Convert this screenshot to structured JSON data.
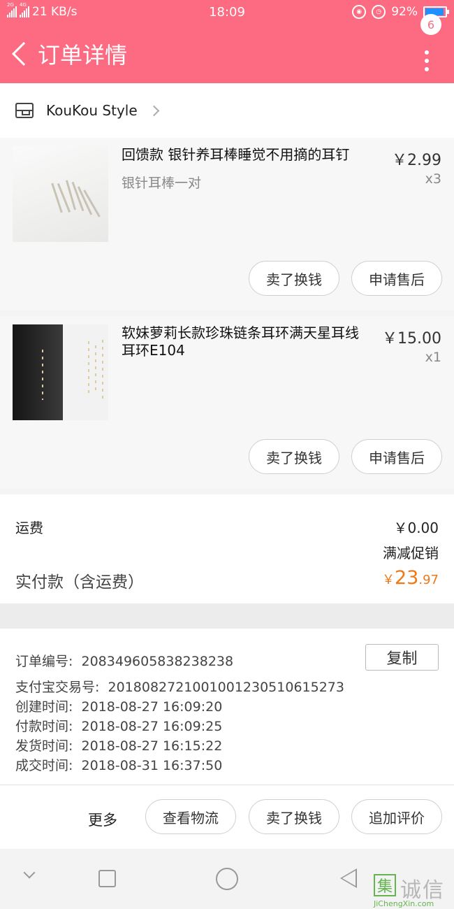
{
  "status_bar": {
    "net_badges": [
      "2G",
      "4G"
    ],
    "speed": "21 KB/s",
    "time": "18:09",
    "alarm_icon": "alarm-icon",
    "battery_percent": "92%",
    "battery_level": 0.92,
    "battery_color": "#1e90ff"
  },
  "header": {
    "title": "订单详情",
    "badge_count": "6",
    "bg_color": "#fd6b82"
  },
  "shop": {
    "name": "KouKou Style"
  },
  "items": [
    {
      "title": "回馈款 银针养耳棒睡觉不用摘的耳钉",
      "subtitle": "银针耳棒一对",
      "price": "￥2.99",
      "qty": "x3",
      "buttons": [
        "卖了换钱",
        "申请售后"
      ]
    },
    {
      "title": "软妹萝莉长款珍珠链条耳环满天星耳线耳环E104",
      "subtitle": "",
      "price": "￥15.00",
      "qty": "x1",
      "buttons": [
        "卖了换钱",
        "申请售后"
      ]
    }
  ],
  "summary": {
    "shipping_label": "运费",
    "shipping_value": "￥0.00",
    "promo_label": "满减促销",
    "paid_label": "实付款（含运费）",
    "paid_currency": "￥",
    "paid_integer": "23",
    "paid_decimal": ".97",
    "accent_color": "#f07815"
  },
  "order_info": {
    "order_no_label": "订单编号:",
    "order_no": "208349605838238238",
    "copy_label": "复制",
    "alipay_label": "支付宝交易号:",
    "alipay_no": "2018082721001001230510615273",
    "created_label": "创建时间:",
    "created": "2018-08-27 16:09:20",
    "paid_label": "付款时间:",
    "paid": "2018-08-27 16:09:25",
    "shipped_label": "发货时间:",
    "shipped": "2018-08-27 16:15:22",
    "completed_label": "成交时间:",
    "completed": "2018-08-31 16:37:50"
  },
  "bottom_actions": {
    "more": "更多",
    "track": "查看物流",
    "sell": "卖了换钱",
    "review": "追加评价"
  },
  "watermark": {
    "logo_char": "集",
    "chars": "诚信",
    "url": "JiChengXin.com"
  }
}
